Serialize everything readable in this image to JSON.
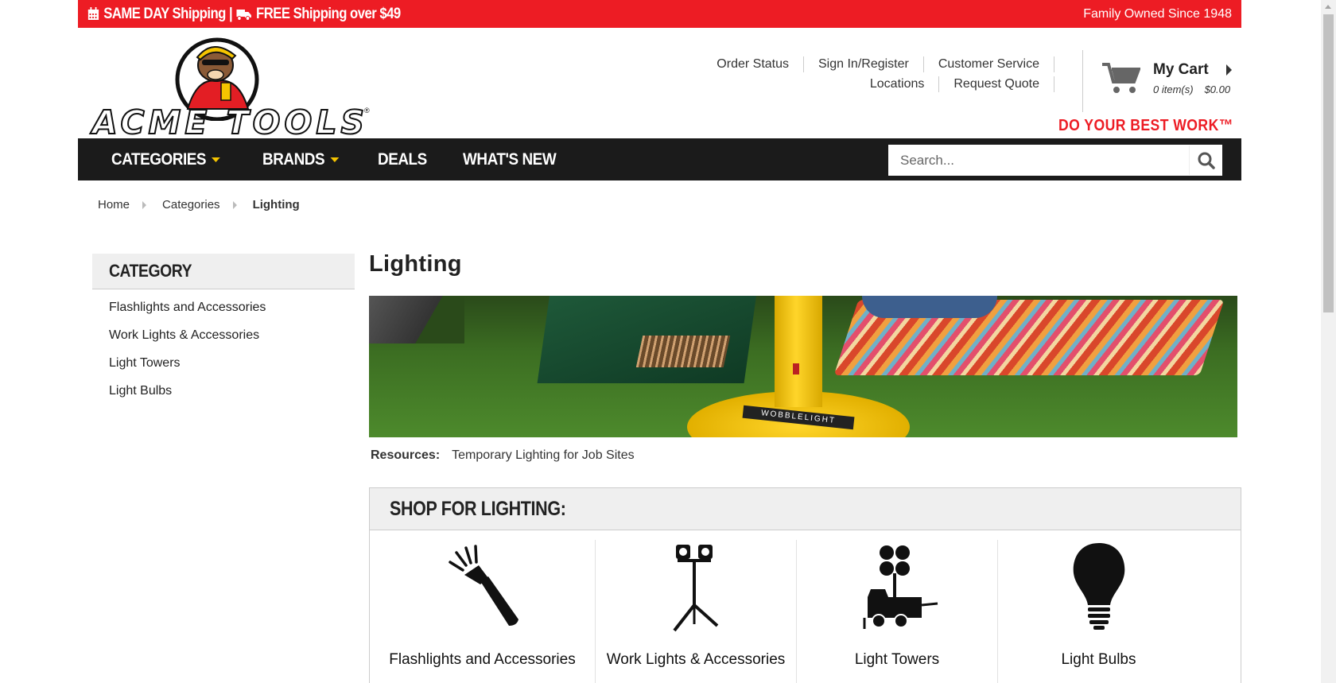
{
  "promo": {
    "left_text_1": "SAME DAY Shipping |",
    "left_text_2": "FREE Shipping over $49",
    "right_text": "Family Owned Since 1948"
  },
  "header": {
    "logo_text": "ACME TOOLS",
    "logo_reg": "®",
    "util_links_row1": [
      "Order Status",
      "Sign In/Register",
      "Customer Service"
    ],
    "util_links_row2": [
      "Locations",
      "Request Quote"
    ],
    "cart": {
      "title": "My Cart",
      "items": "0 item(s)",
      "total": "$0.00"
    },
    "tagline": "DO YOUR BEST WORK™"
  },
  "nav": {
    "items": [
      {
        "label": "CATEGORIES",
        "dropdown": true
      },
      {
        "label": "BRANDS",
        "dropdown": true
      },
      {
        "label": "DEALS",
        "dropdown": false
      },
      {
        "label": "WHAT'S NEW",
        "dropdown": false
      }
    ],
    "search_placeholder": "Search..."
  },
  "breadcrumb": [
    "Home",
    "Categories",
    "Lighting"
  ],
  "sidebar": {
    "heading": "CATEGORY",
    "items": [
      "Flashlights and Accessories",
      "Work Lights & Accessories",
      "Light Towers",
      "Light Bulbs"
    ]
  },
  "main": {
    "title": "Lighting",
    "hero_label": "WOBBLELIGHT",
    "resources_label": "Resources:",
    "resources_link": "Temporary Lighting for Job Sites",
    "shop_heading": "SHOP FOR LIGHTING:",
    "shop_items": [
      {
        "label": "Flashlights and Accessories",
        "icon": "flashlight-icon"
      },
      {
        "label": "Work Lights & Accessories",
        "icon": "tripod-work-light-icon"
      },
      {
        "label": "Light Towers",
        "icon": "light-tower-icon"
      },
      {
        "label": "Light Bulbs",
        "icon": "light-bulb-icon"
      }
    ]
  },
  "colors": {
    "brand_red": "#ed1c24",
    "nav_bg": "#1b1b1b",
    "nav_caret": "#f5c400",
    "panel_bg": "#efefef"
  }
}
